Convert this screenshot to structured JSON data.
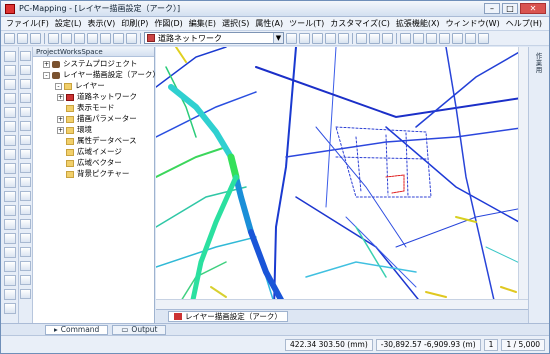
{
  "window": {
    "title": "PC-Mapping - [レイヤー描画設定（アーク）]"
  },
  "menu": [
    "ファイル(F)",
    "設定(L)",
    "表示(V)",
    "印刷(P)",
    "作図(D)",
    "編集(E)",
    "選択(S)",
    "属性(A)",
    "ツール(T)",
    "カスタマイズ(C)",
    "拡張機能(X)",
    "ウィンドウ(W)",
    "ヘルプ(H)"
  ],
  "toolbar": {
    "layer_select_value": "道路ネットワーク"
  },
  "project_panel": {
    "title": "ProjectWorksSpace",
    "tree": [
      {
        "label": "システムプロジェクト",
        "icon": "database-icon",
        "expander": "+"
      },
      {
        "label": "レイヤー描画設定（アーク）",
        "icon": "database-icon",
        "expander": "-"
      },
      {
        "label": "レイヤー",
        "icon": "folder-icon",
        "expander": "-"
      },
      {
        "label": "道路ネットワーク",
        "icon": "road-layer-icon",
        "expander": "+"
      },
      {
        "label": "表示モード",
        "icon": "folder-icon",
        "expander": ""
      },
      {
        "label": "描画パラメーター",
        "icon": "folder-icon",
        "expander": "+"
      },
      {
        "label": "環境",
        "icon": "folder-icon",
        "expander": "+"
      },
      {
        "label": "属性データベース",
        "icon": "folder-icon",
        "expander": ""
      },
      {
        "label": "広域イメージ",
        "icon": "folder-icon",
        "expander": ""
      },
      {
        "label": "広域ベクター",
        "icon": "folder-icon",
        "expander": ""
      },
      {
        "label": "背景ピクチャー",
        "icon": "folder-icon",
        "expander": ""
      }
    ]
  },
  "right_panel": {
    "tab_label": "作業用"
  },
  "map_tab": {
    "label": "レイヤー描画設定（アーク）"
  },
  "bottom_tabs": [
    {
      "label": "Command"
    },
    {
      "label": "Output"
    }
  ],
  "status": {
    "coords": "422.34 303.50 (mm)",
    "world": "-30,892.57 -6,909.93 (m)",
    "page": "1",
    "scale": "1 / 5,000"
  }
}
